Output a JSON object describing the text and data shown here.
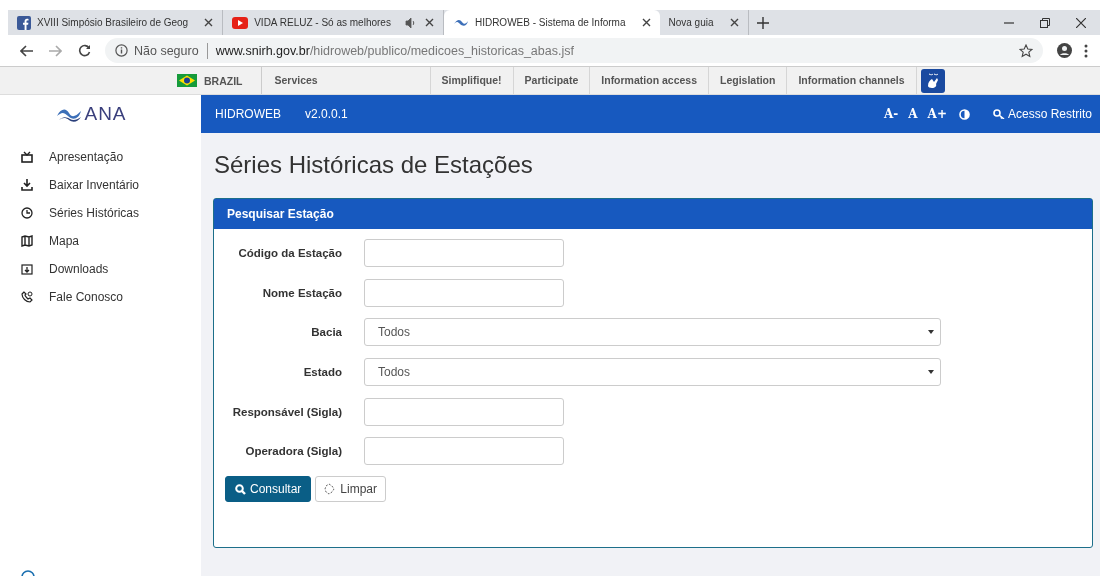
{
  "browser": {
    "tabs": [
      {
        "title": "XVIII Simpósio Brasileiro de Geog",
        "kind": "facebook",
        "audio": false,
        "selected": false
      },
      {
        "title": "VIDA RELUZ - Só as melhores",
        "kind": "youtube",
        "audio": true,
        "selected": false
      },
      {
        "title": "HIDROWEB - Sistema de Informa",
        "kind": "ana",
        "audio": false,
        "selected": true
      },
      {
        "title": "Nova guia",
        "kind": "blank",
        "audio": false,
        "selected": false
      }
    ],
    "security": "Não seguro",
    "url_host": "www.snirh.gov.br",
    "url_path": "/hidroweb/publico/medicoes_historicas_abas.jsf"
  },
  "gov_bar": {
    "country": "BRAZIL",
    "links": [
      "Services",
      "Simplifique!",
      "Participate",
      "Information access",
      "Legislation",
      "Information channels"
    ]
  },
  "logo": "ANA",
  "sidebar": {
    "items": [
      {
        "label": "Apresentação"
      },
      {
        "label": "Baixar Inventário"
      },
      {
        "label": "Séries Históricas"
      },
      {
        "label": "Mapa"
      },
      {
        "label": "Downloads"
      },
      {
        "label": "Fale Conosco"
      }
    ]
  },
  "header": {
    "app": "HIDROWEB",
    "version": "v2.0.0.1",
    "font_controls": [
      "A-",
      "A",
      "A+"
    ],
    "login": "Acesso Restrito"
  },
  "page_title": "Séries Históricas de Estações",
  "panel": {
    "title": "Pesquisar Estação",
    "fields": [
      {
        "label": "Código da Estação",
        "kind": "text"
      },
      {
        "label": "Nome Estação",
        "kind": "text"
      },
      {
        "label": "Bacia",
        "kind": "select",
        "value": "Todos"
      },
      {
        "label": "Estado",
        "kind": "select",
        "value": "Todos"
      },
      {
        "label": "Responsável (Sigla)",
        "kind": "text"
      },
      {
        "label": "Operadora (Sigla)",
        "kind": "text"
      }
    ],
    "buttons": [
      {
        "label": "Consultar",
        "kind": "primary"
      },
      {
        "label": "Limpar",
        "kind": "secondary"
      }
    ]
  }
}
